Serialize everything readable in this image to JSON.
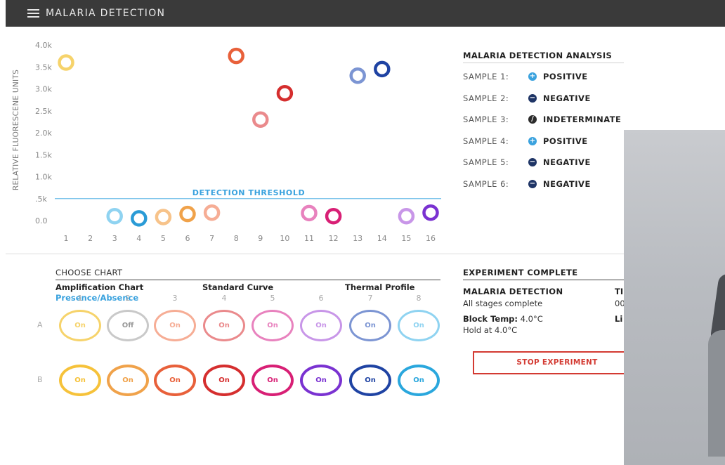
{
  "app": {
    "title": "MALARIA DETECTION"
  },
  "chart_data": {
    "type": "scatter",
    "ylabel": "RELATIVE FLUORESCENE UNITS",
    "xlabel": "",
    "yticks": [
      "4.0k",
      "3.5k",
      "3.0k",
      "2.5k",
      "2.0k",
      "1.5k",
      "1.0k",
      ".5k",
      "0.0"
    ],
    "ylim": [
      0,
      4000
    ],
    "xticks": [
      "1",
      "2",
      "3",
      "4",
      "5",
      "6",
      "7",
      "8",
      "9",
      "10",
      "11",
      "12",
      "13",
      "14",
      "15",
      "16"
    ],
    "threshold": {
      "label": "DETECTION THRESHOLD",
      "value": 500,
      "color": "#6cbde8"
    },
    "grid": false,
    "points": [
      {
        "x": 1,
        "y": 3600,
        "color": "#f6d36b"
      },
      {
        "x": 3,
        "y": 100,
        "color": "#8fd3f1"
      },
      {
        "x": 4,
        "y": 50,
        "color": "#2a9bd6"
      },
      {
        "x": 5,
        "y": 80,
        "color": "#f7c38a"
      },
      {
        "x": 6,
        "y": 150,
        "color": "#f0a24a"
      },
      {
        "x": 7,
        "y": 180,
        "color": "#f6ad95"
      },
      {
        "x": 8,
        "y": 3750,
        "color": "#e8603a"
      },
      {
        "x": 9,
        "y": 2300,
        "color": "#ea8a8c"
      },
      {
        "x": 10,
        "y": 2900,
        "color": "#d52e2e"
      },
      {
        "x": 11,
        "y": 170,
        "color": "#e882be"
      },
      {
        "x": 12,
        "y": 100,
        "color": "#d81f75"
      },
      {
        "x": 13,
        "y": 3300,
        "color": "#7c95d3"
      },
      {
        "x": 14,
        "y": 3450,
        "color": "#1f43a3"
      },
      {
        "x": 15,
        "y": 100,
        "color": "#c896e8"
      },
      {
        "x": 16,
        "y": 180,
        "color": "#7a32d1"
      }
    ]
  },
  "analysis": {
    "title": "MALARIA DETECTION ANALYSIS",
    "samples": [
      {
        "label": "SAMPLE 1:",
        "result": "POSITIVE",
        "type": "positive",
        "icon": "plus-circle-icon"
      },
      {
        "label": "SAMPLE 2:",
        "result": "NEGATIVE",
        "type": "negative",
        "icon": "minus-circle-icon"
      },
      {
        "label": "SAMPLE 3:",
        "result": "INDETERMINATE",
        "type": "indeterminate",
        "icon": "slash-circle-icon"
      },
      {
        "label": "SAMPLE 4:",
        "result": "POSITIVE",
        "type": "positive",
        "icon": "plus-circle-icon"
      },
      {
        "label": "SAMPLE 5:",
        "result": "NEGATIVE",
        "type": "negative",
        "icon": "minus-circle-icon"
      },
      {
        "label": "SAMPLE 6:",
        "result": "NEGATIVE",
        "type": "negative",
        "icon": "minus-circle-icon"
      }
    ]
  },
  "choose_chart": {
    "title": "CHOOSE CHART",
    "tabs": [
      "Amplification Chart",
      "Standard Curve",
      "Thermal Profile"
    ],
    "sub": "Presence/Absence",
    "active_color": "#3aa2de"
  },
  "plate": {
    "columns": [
      "1",
      "2",
      "3",
      "4",
      "5",
      "6",
      "7",
      "8"
    ],
    "rows": [
      {
        "letter": "A",
        "wells": [
          {
            "label": "On",
            "color": "#f6d36b"
          },
          {
            "label": "Off",
            "color": "#c9c9c9"
          },
          {
            "label": "On",
            "color": "#f6ad95"
          },
          {
            "label": "On",
            "color": "#ea8a8c"
          },
          {
            "label": "On",
            "color": "#e882be"
          },
          {
            "label": "On",
            "color": "#c896e8"
          },
          {
            "label": "On",
            "color": "#7c95d3"
          },
          {
            "label": "On",
            "color": "#8fd3f1"
          }
        ]
      },
      {
        "letter": "B",
        "wells": [
          {
            "label": "On",
            "color": "#f6c23a"
          },
          {
            "label": "On",
            "color": "#f0a24a"
          },
          {
            "label": "On",
            "color": "#e8603a"
          },
          {
            "label": "On",
            "color": "#d52e2e"
          },
          {
            "label": "On",
            "color": "#d81f75"
          },
          {
            "label": "On",
            "color": "#7a32d1"
          },
          {
            "label": "On",
            "color": "#1f43a3"
          },
          {
            "label": "On",
            "color": "#2aa7dd"
          }
        ]
      }
    ]
  },
  "experiment": {
    "title": "EXPERIMENT COMPLETE",
    "name": "MALARIA DETECTION",
    "stages": "All stages complete",
    "col2_title": "TI",
    "col2_value": "00",
    "col2_label2": "Li",
    "block_temp_label": "Block Temp:",
    "block_temp_value": "4.0°C",
    "hold": "Hold at 4.0°C",
    "stop_label": "STOP EXPERIMENT"
  }
}
